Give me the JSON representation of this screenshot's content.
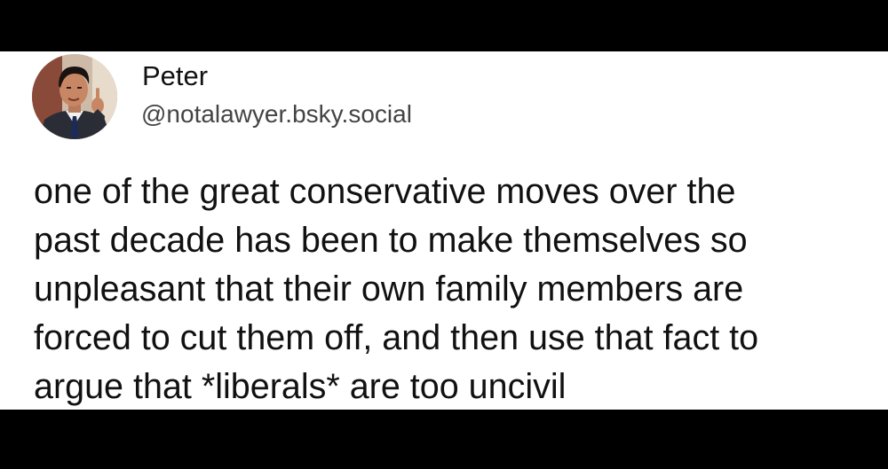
{
  "author": {
    "display_name": "Peter",
    "handle": "@notalawyer.bsky.social",
    "avatar_icon": "profile-photo-man-in-suit-pointing"
  },
  "post": {
    "lines": [
      "one of the great conservative moves over the",
      "past decade has been to make themselves so",
      "unpleasant that their own family members are",
      "forced to cut them off, and then use that fact to",
      "argue that *liberals* are too uncivil"
    ]
  },
  "colors": {
    "background": "#ffffff",
    "frame": "#000000",
    "text": "#111111",
    "handle": "#444444"
  }
}
